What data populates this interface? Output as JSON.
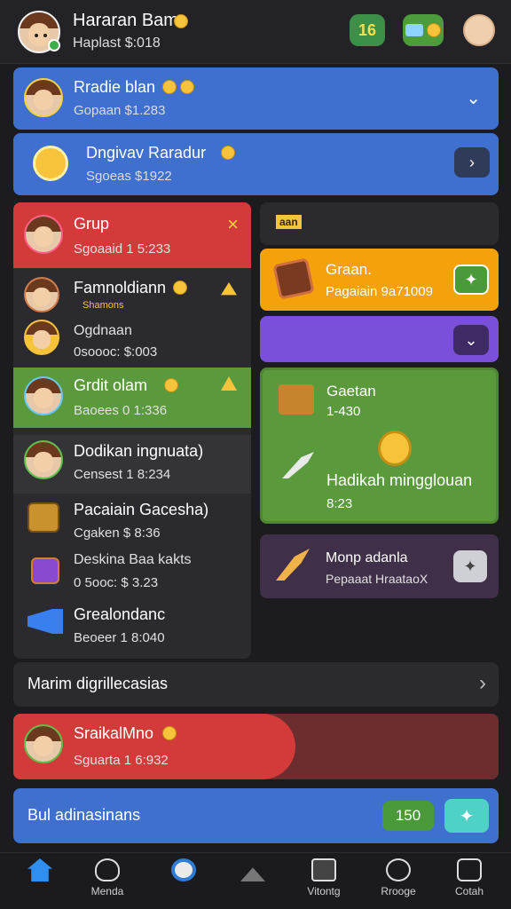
{
  "header": {
    "title": "Hararan Bam",
    "subtitle": "Haplast $:018",
    "badge_count": "16",
    "status_icon": "gift-icon",
    "profile_icon": "smiley-icon"
  },
  "rows": [
    {
      "title": "Rradie blan",
      "sub": "Gopaan $1.283"
    },
    {
      "title": "Dngivav Raradur",
      "sub": "Sgoeas $1922"
    }
  ],
  "left_list": [
    {
      "title": "Grup",
      "sub": "Sgoaaid 1 5:233"
    },
    {
      "title": "Famnoldiann",
      "sub": "Shamons",
      "extra": "Ogdnaan",
      "extra_sub": "0soooc: $:003"
    },
    {
      "title": "Grdit olam",
      "sub": "Baoees 0 1:336"
    },
    {
      "title": "Dodikan ingnuata)",
      "sub": "Censest 1 8:234"
    },
    {
      "title": "Pacaiain Gacesha)",
      "sub": "Cgaken $ 8:36"
    },
    {
      "title": "Deskina Baa kakts",
      "sub": "0 5ooc: $ 3.23"
    },
    {
      "title": "Grealondanc",
      "sub": "Beoeer 1 8:040"
    }
  ],
  "right_panel": {
    "tag": "aan",
    "orange": {
      "title": "Graan.",
      "sub": "Pagaiain 9a71009"
    },
    "green": {
      "title": "Gaetan",
      "sub": "1-430",
      "bottom": "Hadikah mingglouan",
      "bottom_sub": "8:23"
    },
    "purple": {
      "title": "Monp adanla",
      "sub": "Pepaaat HraataoX"
    }
  },
  "more_row": {
    "label": "Marim digrillecasias"
  },
  "red_banner": {
    "title": "SraikalMno",
    "sub": "Sguarta 1 6:932"
  },
  "bottom_bar": {
    "label": "Bul adinasinans",
    "count": "150"
  },
  "nav": [
    {
      "label": "",
      "icon": "home-icon"
    },
    {
      "label": "Menda",
      "icon": "heart-icon"
    },
    {
      "label": "",
      "icon": "search-icon"
    },
    {
      "label": "",
      "icon": "triangle-icon"
    },
    {
      "label": "Vitontg",
      "icon": "gallery-icon"
    },
    {
      "label": "Rrooge",
      "icon": "chat-icon"
    },
    {
      "label": "Cotah",
      "icon": "profile-icon"
    }
  ],
  "colors": {
    "blue": "#3f6fcf",
    "red": "#d33a3a",
    "green": "#5a9a3c",
    "orange": "#f4a10b",
    "purple": "#7a4fd9",
    "dark": "#2a2a2f"
  }
}
